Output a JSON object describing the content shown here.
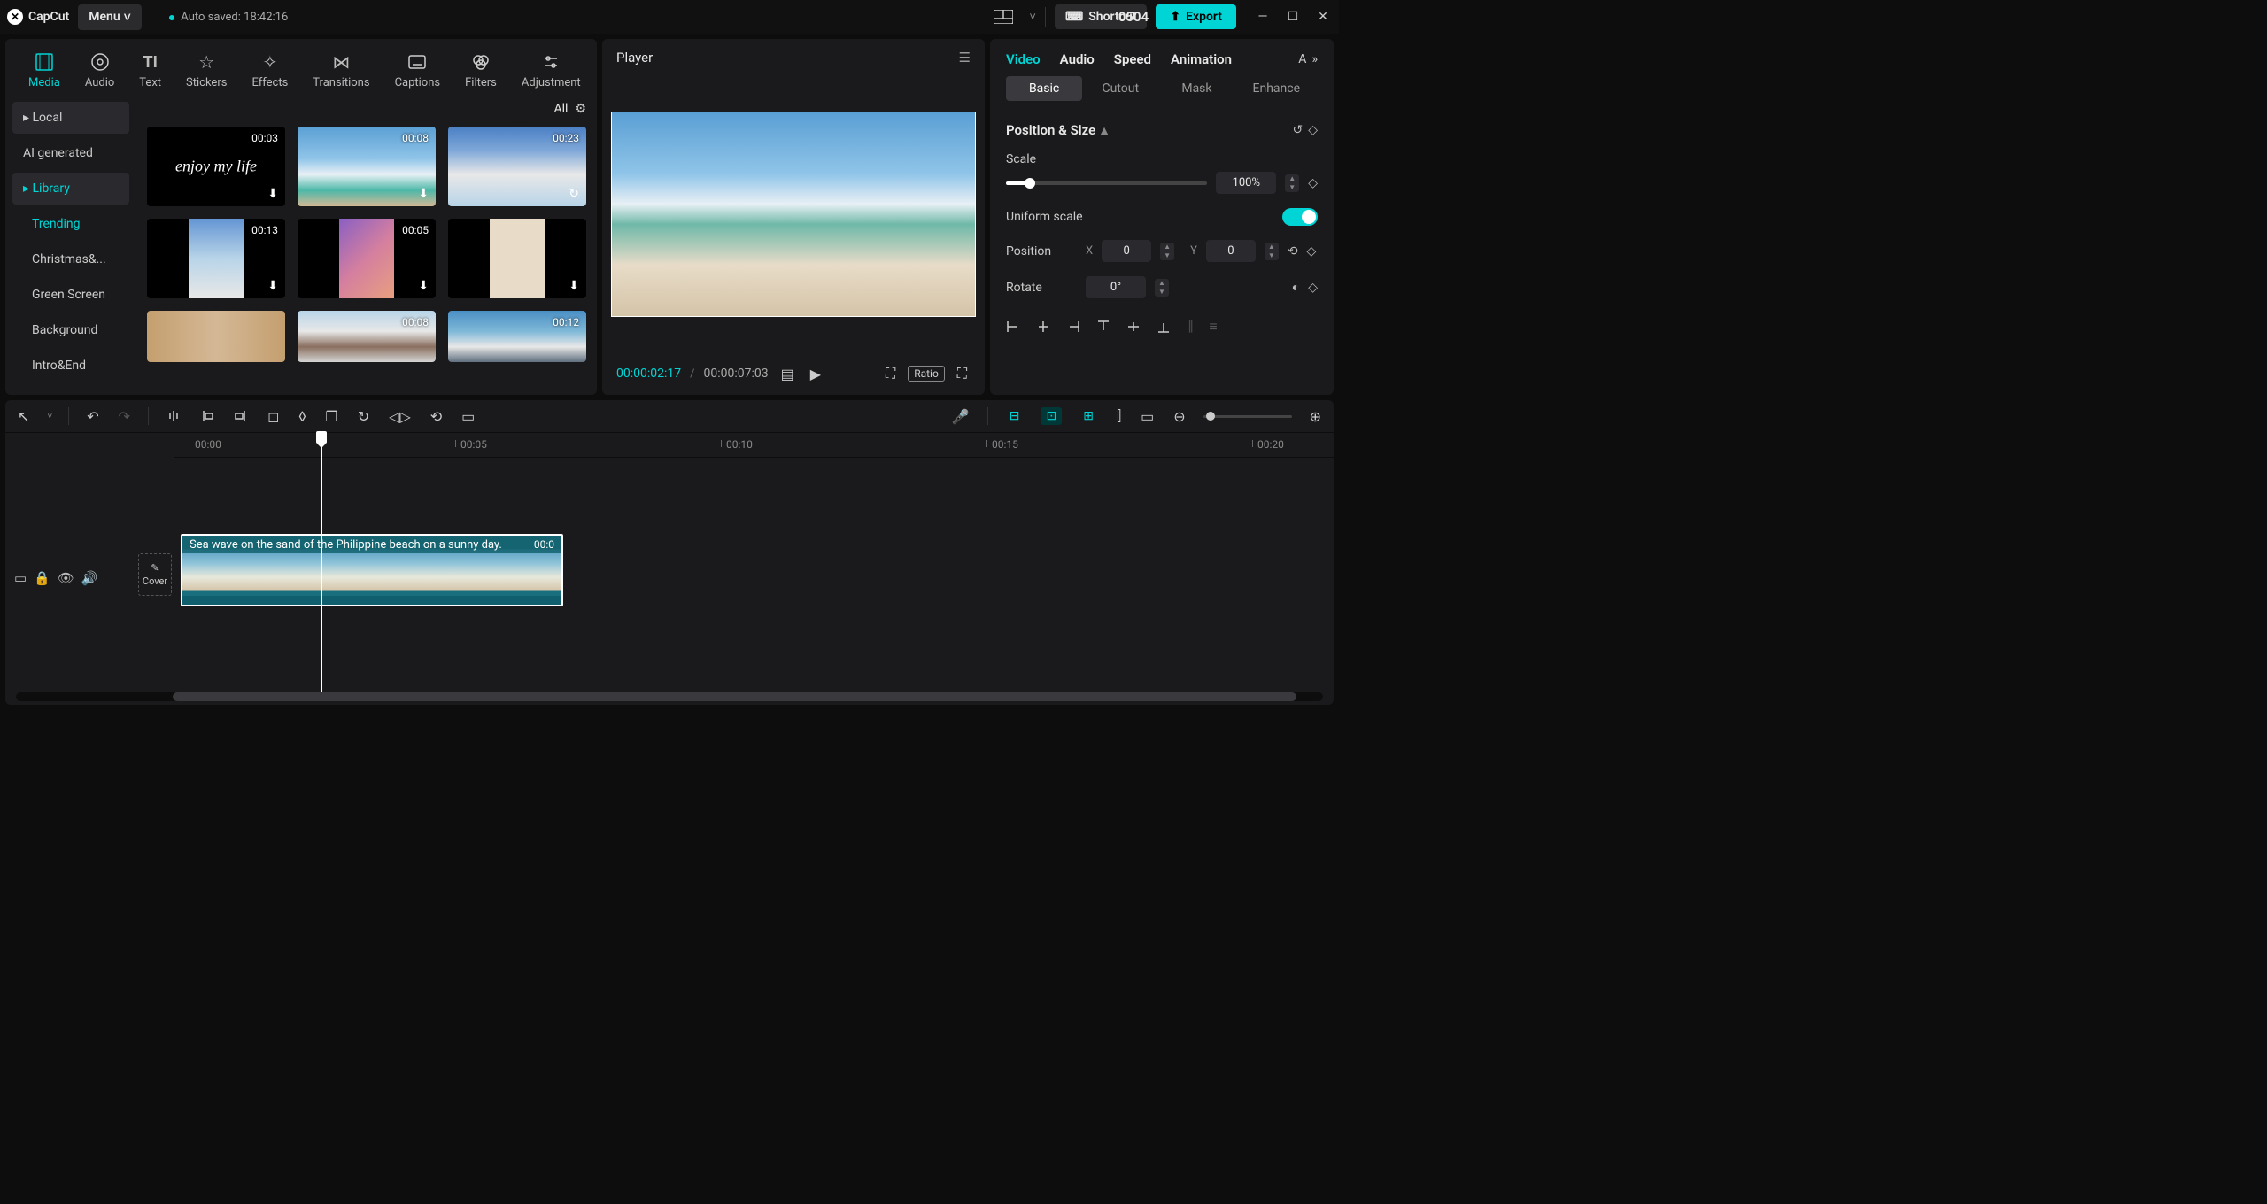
{
  "titlebar": {
    "app_name": "CapCut",
    "menu_label": "Menu",
    "autosave_label": "Auto saved: 18:42:16",
    "project_name": "0504",
    "shortcut_label": "Shortcut",
    "export_label": "Export"
  },
  "media_tabs": [
    {
      "label": "Media",
      "icon": "▦"
    },
    {
      "label": "Audio",
      "icon": "◉"
    },
    {
      "label": "Text",
      "icon": "T"
    },
    {
      "label": "Stickers",
      "icon": "✦"
    },
    {
      "label": "Effects",
      "icon": "✧"
    },
    {
      "label": "Transitions",
      "icon": "⋈"
    },
    {
      "label": "Captions",
      "icon": "▭"
    },
    {
      "label": "Filters",
      "icon": "◐"
    },
    {
      "label": "Adjustment",
      "icon": "⚙"
    }
  ],
  "media_sidebar": {
    "local": "Local",
    "ai": "AI generated",
    "library": "Library",
    "sub": [
      "Trending",
      "Christmas&...",
      "Green Screen",
      "Background",
      "Intro&End"
    ]
  },
  "filter_all": "All",
  "thumbs": [
    {
      "dur": "00:03",
      "txt": "enjoy my life"
    },
    {
      "dur": "00:08"
    },
    {
      "dur": "00:23"
    },
    {
      "dur": "00:13"
    },
    {
      "dur": "00:05"
    },
    {
      "dur": ""
    },
    {
      "dur": ""
    },
    {
      "dur": "00:08"
    },
    {
      "dur": "00:12"
    }
  ],
  "player": {
    "title": "Player",
    "time_current": "00:00:02:17",
    "time_total": "00:00:07:03",
    "ratio_label": "Ratio"
  },
  "inspector": {
    "tabs": [
      "Video",
      "Audio",
      "Speed",
      "Animation"
    ],
    "subtabs": [
      "Basic",
      "Cutout",
      "Mask",
      "Enhance"
    ],
    "section": "Position & Size",
    "scale_label": "Scale",
    "scale_value": "100%",
    "uniform_label": "Uniform scale",
    "position_label": "Position",
    "pos_x": "0",
    "pos_y": "0",
    "rotate_label": "Rotate",
    "rotate_value": "0°"
  },
  "timeline": {
    "ticks": [
      "00:00",
      "00:05",
      "00:10",
      "00:15",
      "00:20"
    ],
    "cover_label": "Cover",
    "clip_title": "Sea wave on the sand of the Philippine beach on a sunny day.",
    "clip_dur": "00:0"
  }
}
